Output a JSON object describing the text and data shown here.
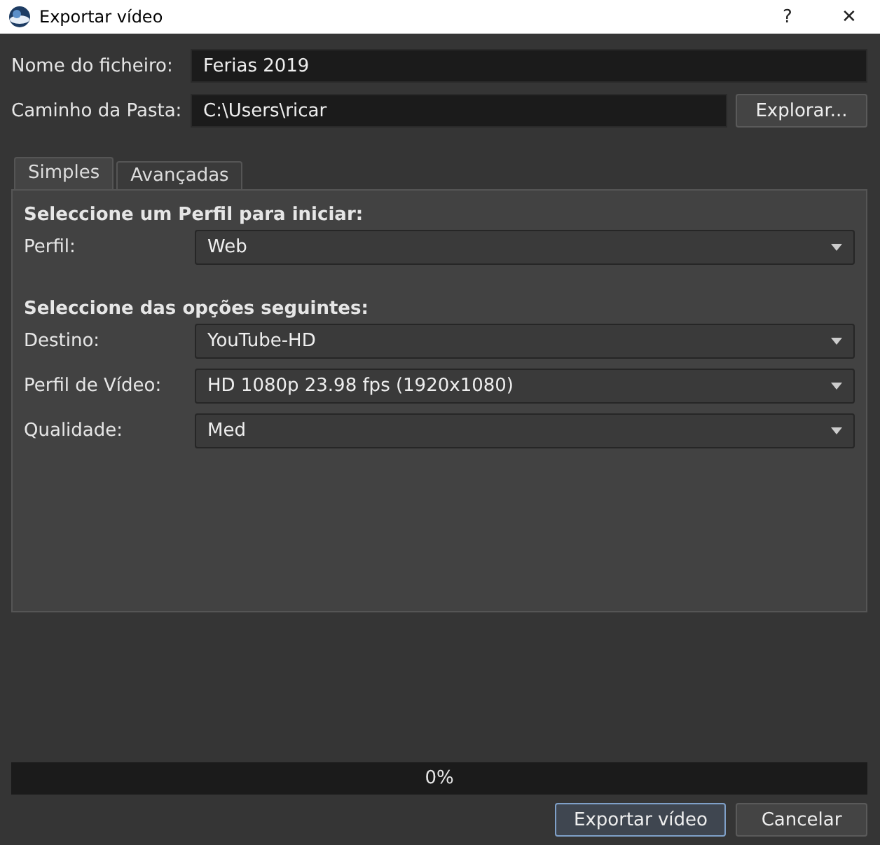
{
  "window": {
    "title": "Exportar vídeo",
    "help": "?",
    "close": "✕"
  },
  "fields": [
    {
      "label": "Nome do ficheiro:",
      "value": "Ferias 2019"
    },
    {
      "label": "Caminho da Pasta:",
      "value": "C:\\Users\\ricar",
      "button": "Explorar..."
    }
  ],
  "tabs": [
    {
      "label": "Simples",
      "selected": true
    },
    {
      "label": "Avançadas",
      "selected": false
    }
  ],
  "sections": [
    {
      "heading": "Seleccione um Perfil para iniciar:",
      "rows": [
        {
          "label": "Perfil:",
          "value": "Web"
        }
      ]
    },
    {
      "heading": "Seleccione das opções seguintes:",
      "rows": [
        {
          "label": "Destino:",
          "value": "YouTube-HD"
        },
        {
          "label": "Perfil de Vídeo:",
          "value": "HD 1080p 23.98 fps (1920x1080)"
        },
        {
          "label": "Qualidade:",
          "value": "Med"
        }
      ]
    }
  ],
  "progress": {
    "level": 0,
    "text": "0%"
  },
  "buttons": [
    {
      "label": "Exportar vídeo",
      "default": true
    },
    {
      "label": "Cancelar",
      "default": false
    }
  ]
}
